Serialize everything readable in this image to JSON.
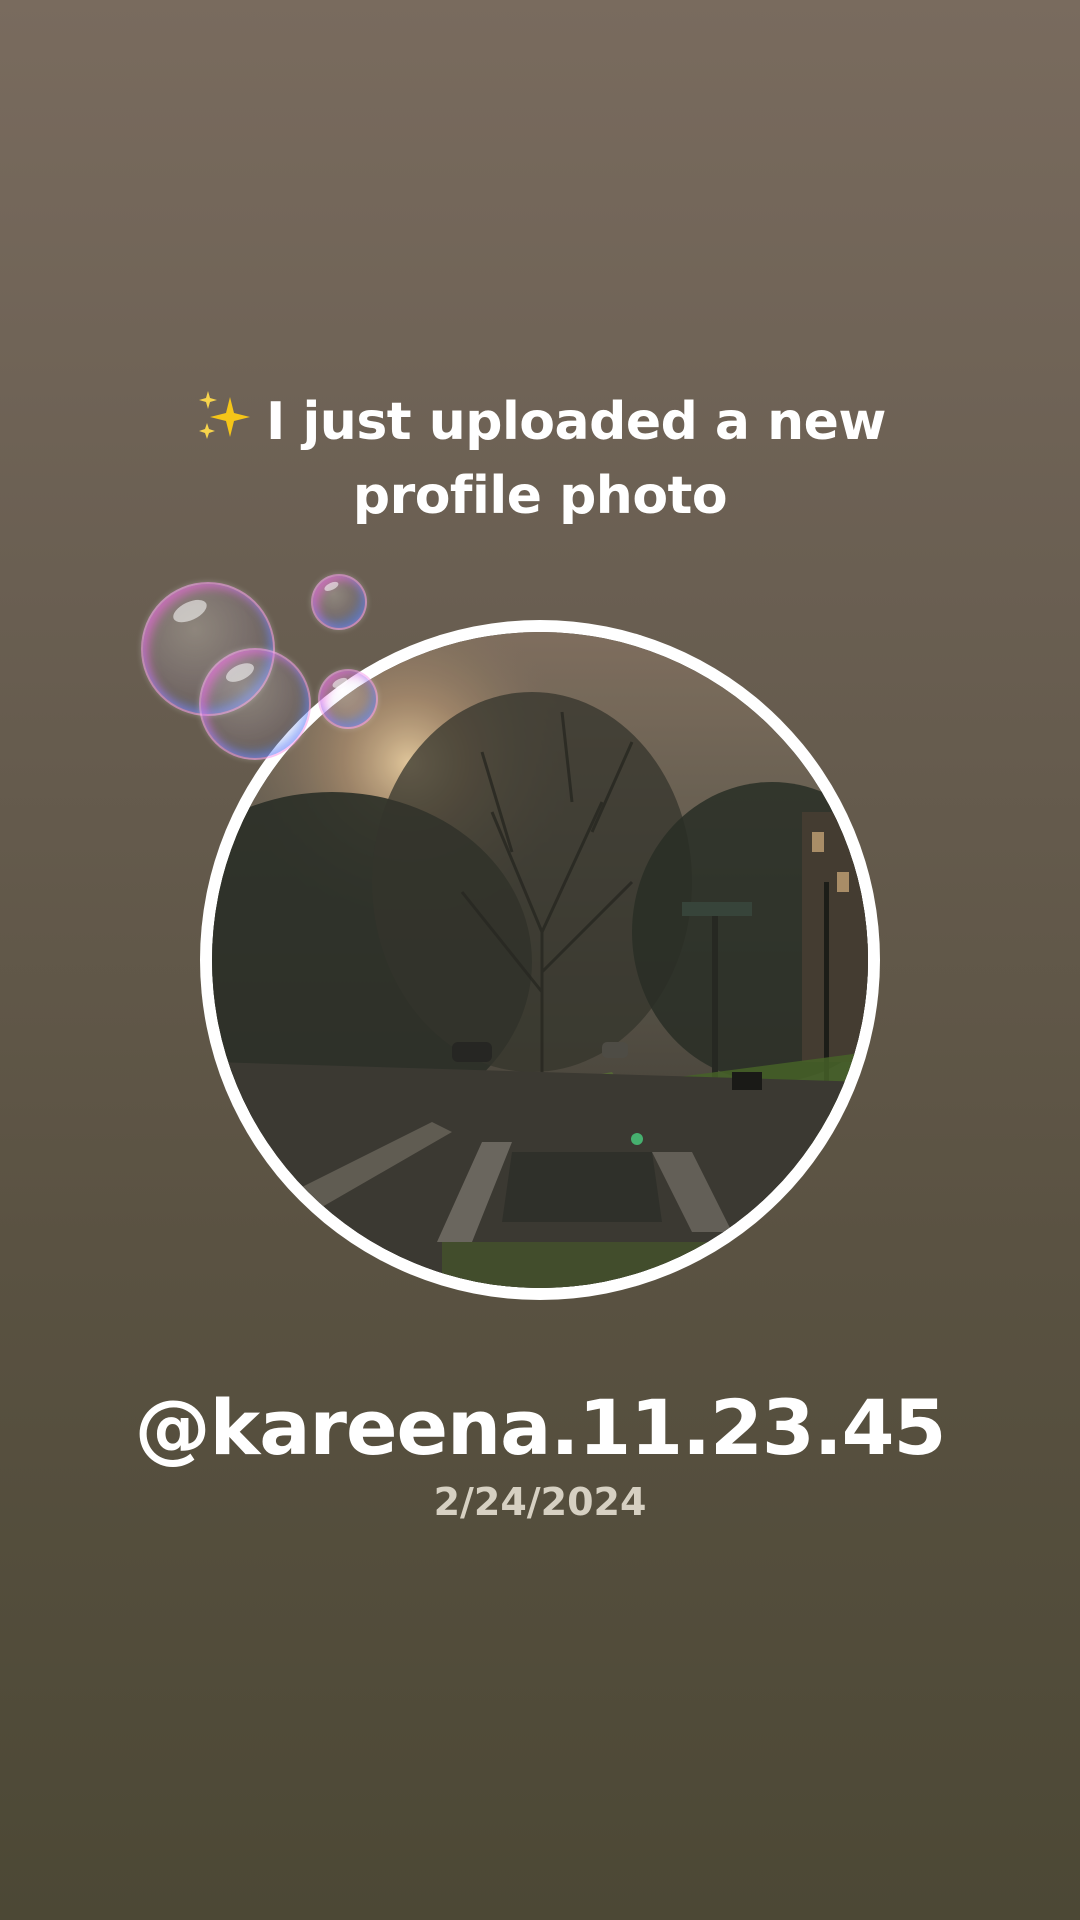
{
  "post": {
    "headline_icon": "sparkles-icon",
    "headline_line1": "I just uploaded a new",
    "headline_line2": "profile photo",
    "username": "@kareena.11.23.45",
    "date": "2/24/2024"
  },
  "colors": {
    "background_top": "#796b5e",
    "background_bottom": "#4c4835",
    "text_primary": "#ffffff",
    "text_secondary": "#d6d0c2",
    "sparkle": "#f5c518",
    "avatar_border": "#ffffff"
  }
}
